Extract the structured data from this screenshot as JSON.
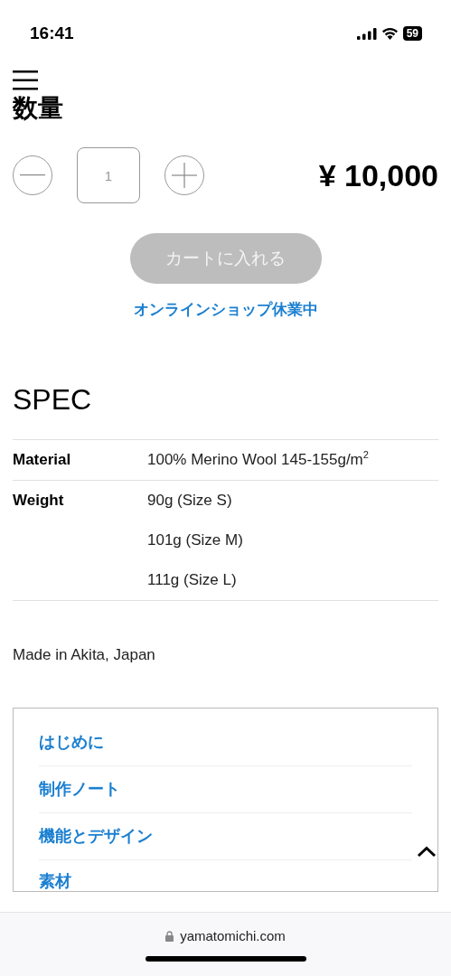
{
  "status_bar": {
    "time": "16:41",
    "battery": "59"
  },
  "quantity": {
    "heading": "数量",
    "value": "1",
    "price": "¥ 10,000"
  },
  "cart_button": {
    "label": "カートに入れる",
    "disabled": true
  },
  "shop_notice": "オンラインショップ休業中",
  "spec": {
    "title": "SPEC",
    "rows": [
      {
        "label": "Material",
        "values": [
          "100% Merino Wool 145-155g/m$^{2}$"
        ]
      },
      {
        "label": "Weight",
        "values": [
          "90g (Size S)",
          "101g (Size M)",
          "111g (Size L)"
        ]
      }
    ]
  },
  "origin": "Made in Akita, Japan",
  "toc": [
    "はじめに",
    "制作ノート",
    "機能とデザイン",
    "素材"
  ],
  "browser_bar": {
    "url": "yamatomichi.com"
  }
}
